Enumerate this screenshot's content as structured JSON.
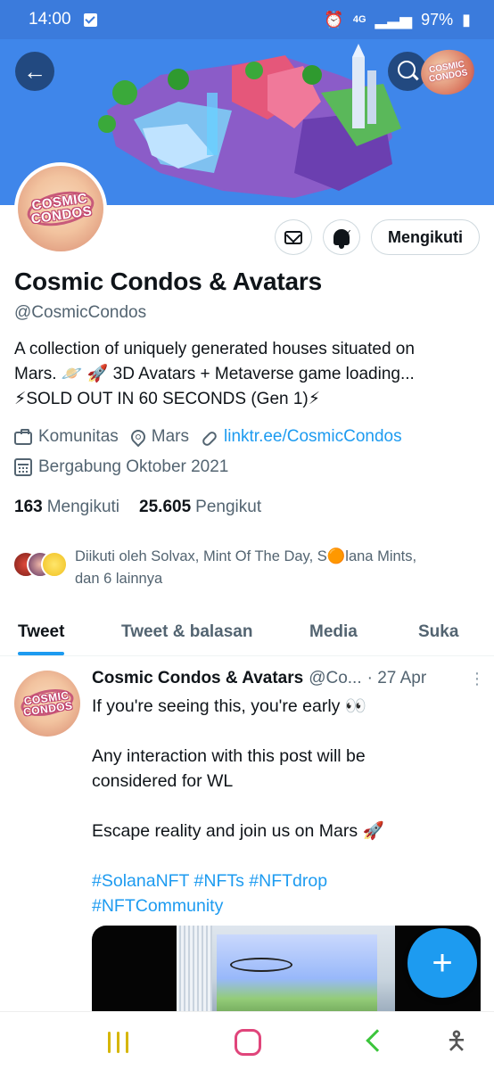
{
  "status_bar": {
    "time": "14:00",
    "network": "4G",
    "battery": "97%"
  },
  "header": {
    "logo_text": "COSMIC CONDOS"
  },
  "profile": {
    "avatar_text": "COSMIC CONDOS",
    "display_name": "Cosmic Condos & Avatars",
    "handle": "@CosmicCondos",
    "follow_label": "Mengikuti",
    "bio_lines": [
      "A collection of uniquely generated houses situated on",
      "Mars. 🪐 🚀 3D Avatars + Metaverse game loading...",
      "⚡SOLD OUT IN 60 SECONDS (Gen 1)⚡"
    ],
    "category": "Komunitas",
    "location": "Mars",
    "link": "linktr.ee/CosmicCondos",
    "joined": "Bergabung Oktober 2021",
    "following_count": "163",
    "following_label": "Mengikuti",
    "followers_count": "25.605",
    "followers_label": "Pengikut",
    "followed_by_lines": [
      "Diikuti oleh Solvax, Mint Of The Day, S🟠lana Mints,",
      "dan 6 lainnya"
    ]
  },
  "tabs": [
    {
      "label": "Tweet"
    },
    {
      "label": "Tweet & balasan"
    },
    {
      "label": "Media"
    },
    {
      "label": "Suka"
    }
  ],
  "tweet": {
    "name": "Cosmic Condos & Avatars",
    "handle": "@Co...",
    "date": "· 27 Apr",
    "more": "⋮",
    "lines": [
      "If you're seeing this, you're early 👀",
      "",
      "Any interaction with this post will be",
      "considered for WL",
      "",
      "Escape reality and join us on Mars 🚀",
      ""
    ],
    "hashtag_lines": [
      "#SolanaNFT #NFTs #NFTdrop",
      "#NFTCommunity"
    ]
  },
  "fab": {
    "label": "+"
  },
  "colors": {
    "accent": "#1d9bf0",
    "status_bar": "#3b7bdc",
    "banner": "#3f86ea"
  }
}
